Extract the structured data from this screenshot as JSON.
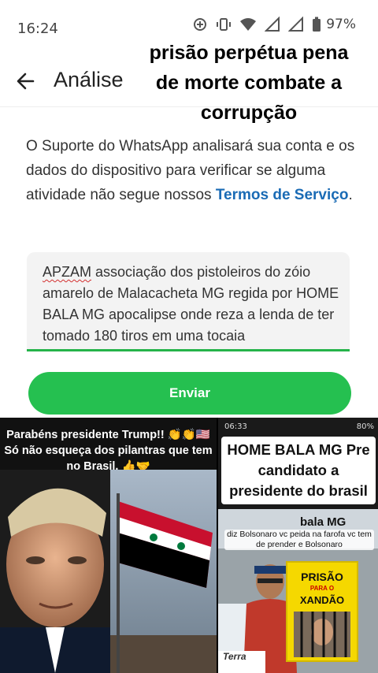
{
  "status_bar": {
    "time": "16:24",
    "battery": "97%"
  },
  "appbar": {
    "title": "Análise"
  },
  "overlay_caption": "prisão perpétua pena de morte combate a corrupção",
  "intro": {
    "text": "O Suporte do WhatsApp analisará sua conta e os dados do dispositivo para verificar se alguma atividade não segue nossos",
    "link": "Termos de Serviço",
    "end": "."
  },
  "textbox": {
    "first_word": "APZAM",
    "value_rest": " associação dos pistoleiros do zóio amarelo de Malacacheta MG regida por HOME BALA MG apocalipse onde reza a lenda de ter tomado 180 tiros em uma tocaia"
  },
  "send_button": {
    "label": "Enviar"
  },
  "collage": {
    "left_caption_line1": "Parabéns presidente Trump!! 👏👏🇺🇸",
    "left_caption_line2": "Só não esqueça dos pilantras que tem",
    "left_caption_line3": "no Brasil. 👍🤝",
    "mini_time": "06:33",
    "mini_battery": "80%",
    "right_caption": "HOME BALA MG Pre candidato a presidente do brasil",
    "bala_label": "bala MG",
    "bolso_caption": "diz Bolsonaro vc peida na farofa vc tem de prender e Bolsonaro",
    "sign_line1": "PRISÃO",
    "sign_line2": "PARA O",
    "sign_line3": "XANDÃO",
    "photo_text": "Terra"
  },
  "colors": {
    "accent_green": "#25c050",
    "link_blue": "#1a6bb5"
  }
}
